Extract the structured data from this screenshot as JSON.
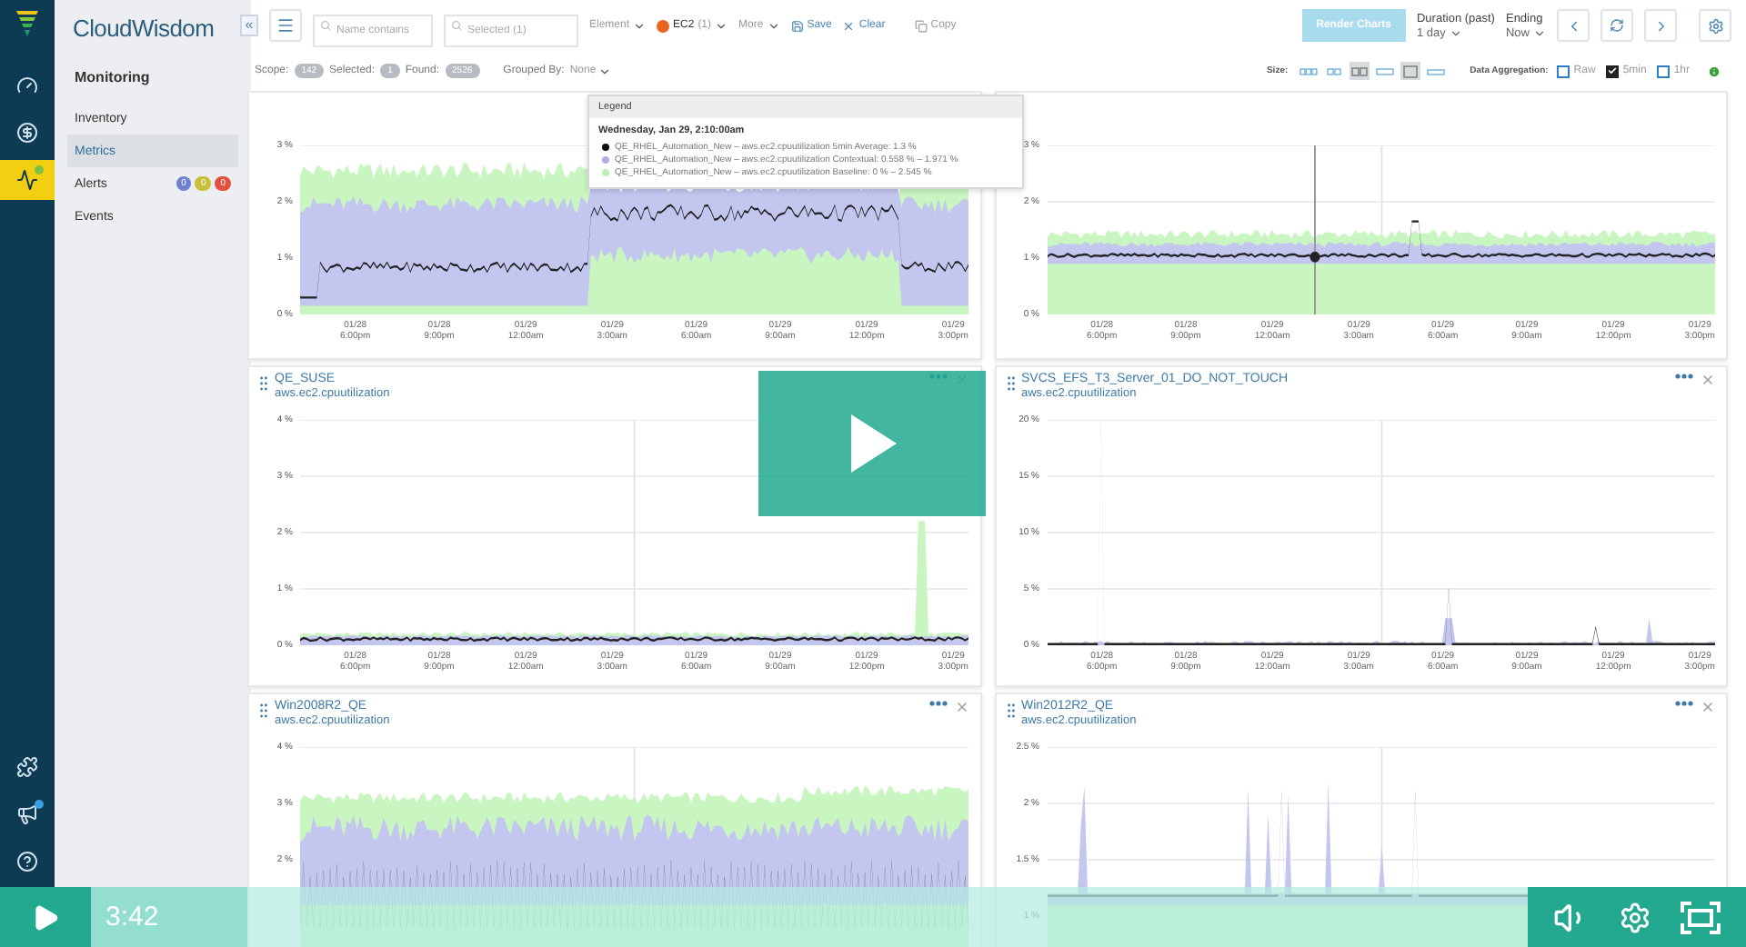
{
  "app": {
    "logo": "CloudWisdom",
    "rail": {
      "top": [
        {
          "kind": "gauge",
          "selected": false
        },
        {
          "kind": "dollar",
          "selected": false
        },
        {
          "kind": "pulse",
          "selected": true,
          "color": "#7cc242"
        }
      ],
      "bottom": [
        {
          "kind": "puzzle",
          "selected": false
        },
        {
          "kind": "megaphone",
          "selected": false,
          "color": "#3aa0e0"
        },
        {
          "kind": "help",
          "selected": false
        }
      ]
    },
    "sidebar": {
      "section": "Monitoring",
      "items": [
        {
          "label": "Inventory",
          "selected": false
        },
        {
          "label": "Metrics",
          "selected": true
        },
        {
          "label": "Alerts",
          "selected": false,
          "badges": [
            {
              "text": "0",
              "color": "#6f80d2"
            },
            {
              "text": "0",
              "color": "#c8c03a"
            },
            {
              "text": "0",
              "color": "#e1533c"
            }
          ]
        },
        {
          "label": "Events",
          "selected": false
        }
      ]
    },
    "toolbar": {
      "collapse": "«",
      "name_placeholder": "Name contains",
      "selected_placeholder": "Selected (1)",
      "element": "Element",
      "ec2": {
        "label": "EC2",
        "count": "(1)"
      },
      "more": "More",
      "save": "Save",
      "clear": "Clear",
      "copy": "Copy",
      "render": {
        "label": "Render Charts",
        "disabled": true
      },
      "duration": {
        "label": "Duration (past)",
        "value": "1 day"
      },
      "ending": {
        "label": "Ending",
        "value": "Now"
      }
    },
    "scope_bar": {
      "scope": {
        "label": "Scope:",
        "count": "142"
      },
      "selected": {
        "label": "Selected:",
        "count": "1"
      },
      "found": {
        "label": "Found:",
        "count": "2526"
      },
      "grouped": {
        "label": "Grouped By:",
        "value": "None"
      },
      "size_label": "Size:",
      "sizes": [
        {
          "kind": "three",
          "selected": false
        },
        {
          "kind": "two",
          "selected": false
        },
        {
          "kind": "pair",
          "selected": true
        },
        {
          "kind": "wide",
          "selected": false
        },
        {
          "kind": "square",
          "selected": true
        },
        {
          "kind": "bar",
          "selected": false
        }
      ],
      "aggregation_label": "Data Aggregation:",
      "aggregation": [
        {
          "label": "Raw",
          "checked": false
        },
        {
          "label": "5min",
          "checked": true
        },
        {
          "label": "1hr",
          "checked": false
        }
      ]
    },
    "legend": {
      "title": "Legend",
      "time": "Wednesday, Jan 29, 2:10:00am",
      "entries": [
        {
          "text": "QE_RHEL_Automation_New – aws.ec2.cpuutilization 5min Average: 1.3 %",
          "color": "#111111"
        },
        {
          "text": "QE_RHEL_Automation_New – aws.ec2.cpuutilization Contextual: 0.558 % – 1.971 %",
          "color": "#a9aee6"
        },
        {
          "text": "QE_RHEL_Automation_New – aws.ec2.cpuutilization Baseline: 0 % – 2.545 %",
          "color": "#bdf0b4"
        }
      ]
    },
    "charts": [
      {
        "y_ticks": [
          "3 %",
          "2 %",
          "1 %",
          "0 %"
        ],
        "x_ticks": [
          {
            "date": "01/28",
            "time": "6:00pm"
          },
          {
            "date": "01/28",
            "time": "9:00pm"
          },
          {
            "date": "01/29",
            "time": "12:00am"
          },
          {
            "date": "01/29",
            "time": "3:00am"
          },
          {
            "date": "01/29",
            "time": "6:00am"
          },
          {
            "date": "01/29",
            "time": "9:00am"
          },
          {
            "date": "01/29",
            "time": "12:00pm"
          },
          {
            "date": "01/29",
            "time": "3:00pm"
          }
        ]
      },
      {
        "y_ticks": [
          "3 %",
          "2 %",
          "1 %",
          "0 %"
        ],
        "x_ticks": [
          {
            "date": "01/28",
            "time": "6:00pm"
          },
          {
            "date": "01/28",
            "time": "9:00pm"
          },
          {
            "date": "01/29",
            "time": "12:00am"
          },
          {
            "date": "01/29",
            "time": "3:00am"
          },
          {
            "date": "01/29",
            "time": "6:00am"
          },
          {
            "date": "01/29",
            "time": "9:00am"
          },
          {
            "date": "01/29",
            "time": "12:00pm"
          },
          {
            "date": "01/29",
            "time": "3:00pm"
          }
        ]
      },
      {
        "title": "QE_SUSE",
        "metric": "aws.ec2.cpuutilization",
        "y_ticks": [
          "4 %",
          "3 %",
          "2 %",
          "1 %",
          "0 %"
        ],
        "x_ticks": [
          {
            "date": "01/28",
            "time": "6:00pm"
          },
          {
            "date": "01/28",
            "time": "9:00pm"
          },
          {
            "date": "01/29",
            "time": "12:00am"
          },
          {
            "date": "01/29",
            "time": "3:00am"
          },
          {
            "date": "01/29",
            "time": "6:00am"
          },
          {
            "date": "01/29",
            "time": "9:00am"
          },
          {
            "date": "01/29",
            "time": "12:00pm"
          },
          {
            "date": "01/29",
            "time": "3:00pm"
          }
        ]
      },
      {
        "title": "SVCS_EFS_T3_Server_01_DO_NOT_TOUCH",
        "metric": "aws.ec2.cpuutilization",
        "y_ticks": [
          "20 %",
          "15 %",
          "10 %",
          "5 %",
          "0 %"
        ],
        "x_ticks": [
          {
            "date": "01/28",
            "time": "6:00pm"
          },
          {
            "date": "01/28",
            "time": "9:00pm"
          },
          {
            "date": "01/29",
            "time": "12:00am"
          },
          {
            "date": "01/29",
            "time": "3:00am"
          },
          {
            "date": "01/29",
            "time": "6:00am"
          },
          {
            "date": "01/29",
            "time": "9:00am"
          },
          {
            "date": "01/29",
            "time": "12:00pm"
          },
          {
            "date": "01/29",
            "time": "3:00pm"
          }
        ]
      },
      {
        "title": "Win2008R2_QE",
        "metric": "aws.ec2.cpuutilization",
        "y_ticks": [
          "4 %",
          "3 %",
          "2 %"
        ]
      },
      {
        "title": "Win2012R2_QE",
        "metric": "aws.ec2.cpuutilization",
        "y_ticks": [
          "2.5 %",
          "2 %",
          "1.5 %",
          "1 %"
        ]
      }
    ]
  },
  "video": {
    "time": "3:42"
  }
}
